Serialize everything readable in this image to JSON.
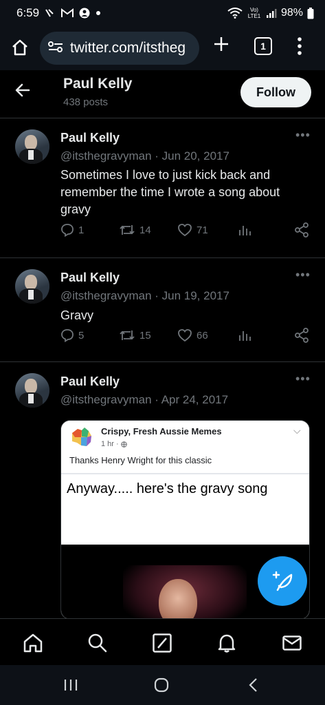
{
  "status_bar": {
    "time": "6:59",
    "battery": "98%",
    "network_label": "Vo) LTE1"
  },
  "browser": {
    "url": "twitter.com/itstheg",
    "tab_count": "1"
  },
  "profile": {
    "name": "Paul Kelly",
    "posts": "438 posts",
    "follow_label": "Follow"
  },
  "tweets": [
    {
      "name": "Paul Kelly",
      "meta": "@itsthegravyman · Jun 20, 2017",
      "text": "Sometimes I love to just kick back and remember the time I wrote a song about gravy",
      "replies": "1",
      "retweets": "14",
      "likes": "71"
    },
    {
      "name": "Paul Kelly",
      "meta": "@itsthegravyman · Jun 19, 2017",
      "text": "Gravy",
      "replies": "5",
      "retweets": "15",
      "likes": "66"
    },
    {
      "name": "Paul Kelly",
      "meta": "@itsthegravyman · Apr 24, 2017",
      "text": "",
      "media": {
        "page_name": "Crispy, Fresh Aussie Memes",
        "time": "1 hr · ",
        "caption": "Thanks Henry Wright for this classic",
        "meme_text": "Anyway..... here's the gravy song"
      }
    }
  ],
  "colors": {
    "accent": "#1d9bf0",
    "background": "#000000",
    "secondary_text": "#71767b",
    "divider": "#2f3336"
  }
}
